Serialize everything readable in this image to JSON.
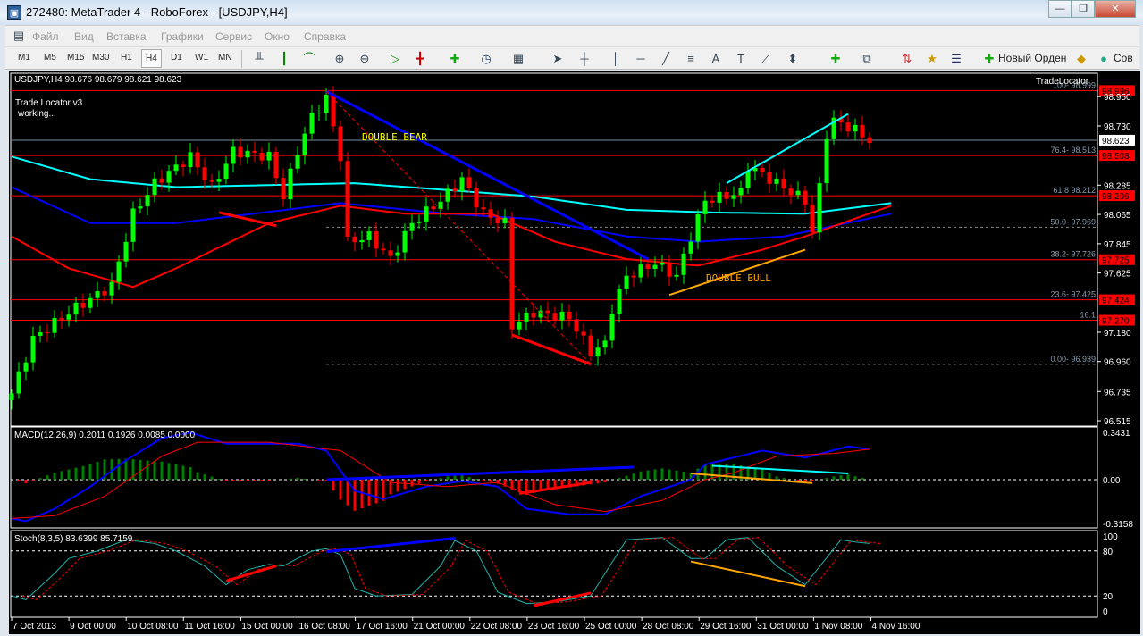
{
  "window": {
    "title": "272480: MetaTrader 4 - RoboForex - [USDJPY,H4]",
    "minimize": "—",
    "restore": "❐",
    "close": "✕"
  },
  "menu": [
    "Файл",
    "Вид",
    "Вставка",
    "Графики",
    "Сервис",
    "Окно",
    "Справка"
  ],
  "timeframes": [
    "M1",
    "M5",
    "M15",
    "M30",
    "H1",
    "H4",
    "D1",
    "W1",
    "MN"
  ],
  "active_timeframe": "H4",
  "toolbar": {
    "new_order": "Новый Орден",
    "advisors": "Сов"
  },
  "chart": {
    "header": "USDJPY,H4  98.676 98.679 98.621 98.623",
    "indicator_name": "Trade Locator v3",
    "indicator_status": "working...",
    "tradelocator_label": "TradeLocator",
    "annotations": {
      "bear": "DOUBLE BEAR",
      "bull": "DOUBLE BULL"
    },
    "colors": {
      "bull": "#00ff00",
      "bear": "#ff0000",
      "ma1": "#00ffff",
      "ma2": "#0000ff",
      "ma3": "#ff0000",
      "bear_text": "#ffff00",
      "bull_text": "#ffa500"
    }
  },
  "chart_data": {
    "type": "candlestick",
    "symbol": "USDJPY",
    "timeframe": "H4",
    "ylim": [
      96.48,
      99.05
    ],
    "price_ticks": [
      "98.950",
      "98.730",
      "98.285",
      "98.065",
      "97.845",
      "97.625",
      "97.180",
      "96.960",
      "96.735",
      "96.515"
    ],
    "price_tick_values": [
      98.95,
      98.73,
      98.285,
      98.065,
      97.845,
      97.625,
      97.18,
      96.96,
      96.735,
      96.515
    ],
    "current_price": "98.623",
    "levels": [
      {
        "price": 98.996,
        "label": "98.996",
        "fib": "100- 98.999"
      },
      {
        "price": 98.508,
        "label": "98.508",
        "fib": "76.4- 98.513"
      },
      {
        "price": 98.206,
        "label": "98.206",
        "fib": "61.8 98.212"
      },
      {
        "price": 97.725,
        "label": "97.725",
        "fib": "38.2- 97.726"
      },
      {
        "price": 97.424,
        "label": "97.424",
        "fib": "23.6- 97.425"
      },
      {
        "price": 97.27,
        "label": "97.270",
        "fib": "16.1"
      }
    ],
    "dashed_levels": [
      {
        "price": 97.969,
        "fib": "50.0- 97.969"
      },
      {
        "price": 96.939,
        "fib": "0.00- 96.939"
      }
    ],
    "close_path": [
      [
        0,
        96.72
      ],
      [
        3,
        97.13
      ],
      [
        8,
        97.33
      ],
      [
        14,
        97.53
      ],
      [
        17,
        98.07
      ],
      [
        20,
        98.3
      ],
      [
        25,
        98.5
      ],
      [
        28,
        98.27
      ],
      [
        31,
        98.54
      ],
      [
        36,
        98.5
      ],
      [
        38,
        98.2
      ],
      [
        40,
        98.54
      ],
      [
        42,
        98.8
      ],
      [
        44,
        98.94
      ],
      [
        46,
        98.5
      ],
      [
        47,
        97.86
      ],
      [
        50,
        97.9
      ],
      [
        53,
        97.73
      ],
      [
        56,
        98.0
      ],
      [
        60,
        98.17
      ],
      [
        63,
        98.33
      ],
      [
        66,
        98.07
      ],
      [
        69,
        98.0
      ],
      [
        70,
        97.23
      ],
      [
        73,
        97.33
      ],
      [
        78,
        97.29
      ],
      [
        81,
        97.03
      ],
      [
        83,
        97.09
      ],
      [
        84,
        97.36
      ],
      [
        86,
        97.6
      ],
      [
        90,
        97.7
      ],
      [
        93,
        97.6
      ],
      [
        95,
        97.9
      ],
      [
        97,
        98.17
      ],
      [
        102,
        98.23
      ],
      [
        103,
        98.43
      ],
      [
        107,
        98.3
      ],
      [
        111,
        98.17
      ],
      [
        112,
        97.93
      ],
      [
        113,
        98.27
      ],
      [
        114,
        98.67
      ],
      [
        115,
        98.77
      ],
      [
        118,
        98.7
      ],
      [
        120,
        98.62
      ]
    ],
    "ma_cyan": [
      [
        0,
        98.5
      ],
      [
        11,
        98.33
      ],
      [
        23,
        98.27
      ],
      [
        48,
        98.3
      ],
      [
        73,
        98.2
      ],
      [
        86,
        98.1
      ],
      [
        98,
        98.08
      ],
      [
        111,
        98.07
      ],
      [
        123,
        98.15
      ]
    ],
    "ma_blue": [
      [
        0,
        98.27
      ],
      [
        11,
        98.0
      ],
      [
        23,
        98.0
      ],
      [
        46,
        98.15
      ],
      [
        61,
        98.07
      ],
      [
        73,
        98.03
      ],
      [
        86,
        97.9
      ],
      [
        96,
        97.86
      ],
      [
        108,
        97.9
      ],
      [
        123,
        98.07
      ]
    ],
    "ma_red": [
      [
        0,
        97.9
      ],
      [
        8,
        97.66
      ],
      [
        17,
        97.52
      ],
      [
        23,
        97.66
      ],
      [
        36,
        98.0
      ],
      [
        46,
        98.13
      ],
      [
        55,
        98.07
      ],
      [
        67,
        98.07
      ],
      [
        76,
        97.86
      ],
      [
        86,
        97.73
      ],
      [
        96,
        97.68
      ],
      [
        105,
        97.8
      ],
      [
        111,
        97.9
      ],
      [
        123,
        98.13
      ]
    ],
    "trendlines": [
      {
        "from": [
          44,
          98.99
        ],
        "to": [
          89,
          97.73
        ],
        "color": "#0000ff",
        "w": 3
      },
      {
        "from": [
          44,
          98.99
        ],
        "to": [
          81,
          96.94
        ],
        "color": "#ff0000",
        "w": 1,
        "dash": true
      },
      {
        "from": [
          29,
          98.08
        ],
        "to": [
          37,
          97.98
        ],
        "color": "#ff0000",
        "w": 3
      },
      {
        "from": [
          70,
          97.16
        ],
        "to": [
          81,
          96.94
        ],
        "color": "#ff0000",
        "w": 3
      },
      {
        "from": [
          100,
          98.3
        ],
        "to": [
          117,
          98.82
        ],
        "color": "#00ffff",
        "w": 2
      },
      {
        "from": [
          92,
          97.46
        ],
        "to": [
          111,
          97.8
        ],
        "color": "#ffa500",
        "w": 2
      }
    ],
    "dates": [
      "7 Oct 2013",
      "9 Oct 00:00",
      "10 Oct 08:00",
      "11 Oct 16:00",
      "15 Oct 00:00",
      "16 Oct 08:00",
      "17 Oct 16:00",
      "21 Oct 00:00",
      "22 Oct 08:00",
      "23 Oct 16:00",
      "25 Oct 00:00",
      "28 Oct 08:00",
      "29 Oct 16:00",
      "31 Oct 00:00",
      "1 Nov 08:00",
      "4 Nov 16:00"
    ],
    "macd": {
      "label": "MACD(12,26,9) 0.2011 0.1926 0.0085 0.0000",
      "ylim": [
        -0.3158,
        0.3431
      ],
      "ticks": [
        "0.3431",
        "0.00",
        "-0.3158"
      ],
      "main": [
        [
          0,
          -0.28
        ],
        [
          2,
          -0.3
        ],
        [
          6,
          -0.21
        ],
        [
          11,
          -0.05
        ],
        [
          16,
          0.14
        ],
        [
          21,
          0.3
        ],
        [
          25,
          0.34
        ],
        [
          30,
          0.26
        ],
        [
          40,
          0.26
        ],
        [
          44,
          0.21
        ],
        [
          48,
          -0.08
        ],
        [
          52,
          -0.14
        ],
        [
          58,
          -0.05
        ],
        [
          63,
          -0.01
        ],
        [
          68,
          -0.05
        ],
        [
          72,
          -0.21
        ],
        [
          78,
          -0.25
        ],
        [
          83,
          -0.25
        ],
        [
          88,
          -0.12
        ],
        [
          95,
          0
        ],
        [
          97,
          0.11
        ],
        [
          105,
          0.21
        ],
        [
          111,
          0.16
        ],
        [
          117,
          0.24
        ],
        [
          120,
          0.22
        ]
      ],
      "signal": [
        [
          0,
          -0.28
        ],
        [
          6,
          -0.26
        ],
        [
          13,
          -0.12
        ],
        [
          21,
          0.17
        ],
        [
          26,
          0.27
        ],
        [
          36,
          0.27
        ],
        [
          46,
          0.21
        ],
        [
          53,
          -0.02
        ],
        [
          61,
          -0.05
        ],
        [
          68,
          -0.02
        ],
        [
          76,
          -0.18
        ],
        [
          83,
          -0.23
        ],
        [
          91,
          -0.15
        ],
        [
          97,
          0
        ],
        [
          101,
          0.05
        ],
        [
          107,
          0.17
        ],
        [
          115,
          0.19
        ],
        [
          120,
          0.22
        ]
      ],
      "trendlines": [
        {
          "from": [
            44,
            0
          ],
          "to": [
            87,
            0.09
          ],
          "color": "#0000ff",
          "w": 3
        },
        {
          "from": [
            71,
            -0.1
          ],
          "to": [
            81,
            -0.02
          ],
          "color": "#ff0000",
          "w": 3
        },
        {
          "from": [
            98,
            0.1
          ],
          "to": [
            117,
            0.045
          ],
          "color": "#00ffff",
          "w": 2
        },
        {
          "from": [
            95,
            0.045
          ],
          "to": [
            112,
            -0.025
          ],
          "color": "#ffa500",
          "w": 2
        }
      ]
    },
    "stoch": {
      "label": "Stoch(8,3,5) 83.6399 85.7159",
      "ylim": [
        0,
        100
      ],
      "ticks": [
        "100",
        "80",
        "20",
        "0"
      ],
      "k": [
        [
          0,
          20
        ],
        [
          2,
          15
        ],
        [
          6,
          50
        ],
        [
          8,
          70
        ],
        [
          12,
          80
        ],
        [
          16,
          95
        ],
        [
          20,
          90
        ],
        [
          23,
          80
        ],
        [
          27,
          60
        ],
        [
          30,
          35
        ],
        [
          33,
          55
        ],
        [
          36,
          62
        ],
        [
          38,
          60
        ],
        [
          42,
          80
        ],
        [
          44,
          83
        ],
        [
          46,
          75
        ],
        [
          48,
          30
        ],
        [
          51,
          20
        ],
        [
          56,
          22
        ],
        [
          60,
          60
        ],
        [
          62,
          94
        ],
        [
          65,
          80
        ],
        [
          68,
          25
        ],
        [
          72,
          10
        ],
        [
          76,
          12
        ],
        [
          81,
          20
        ],
        [
          86,
          95
        ],
        [
          91,
          98
        ],
        [
          95,
          70
        ],
        [
          97,
          70
        ],
        [
          100,
          95
        ],
        [
          103,
          98
        ],
        [
          107,
          60
        ],
        [
          111,
          35
        ],
        [
          116,
          95
        ],
        [
          118,
          92
        ],
        [
          120,
          90
        ]
      ],
      "trendlines": [
        {
          "from": [
            44,
            79
          ],
          "to": [
            62,
            97
          ],
          "color": "#0000ff",
          "w": 3
        },
        {
          "from": [
            30,
            40
          ],
          "to": [
            37,
            60
          ],
          "color": "#ff0000",
          "w": 3
        },
        {
          "from": [
            73,
            7
          ],
          "to": [
            81,
            24
          ],
          "color": "#ff0000",
          "w": 3
        },
        {
          "from": [
            95,
            66
          ],
          "to": [
            111,
            33
          ],
          "color": "#ffa500",
          "w": 2
        }
      ]
    }
  }
}
